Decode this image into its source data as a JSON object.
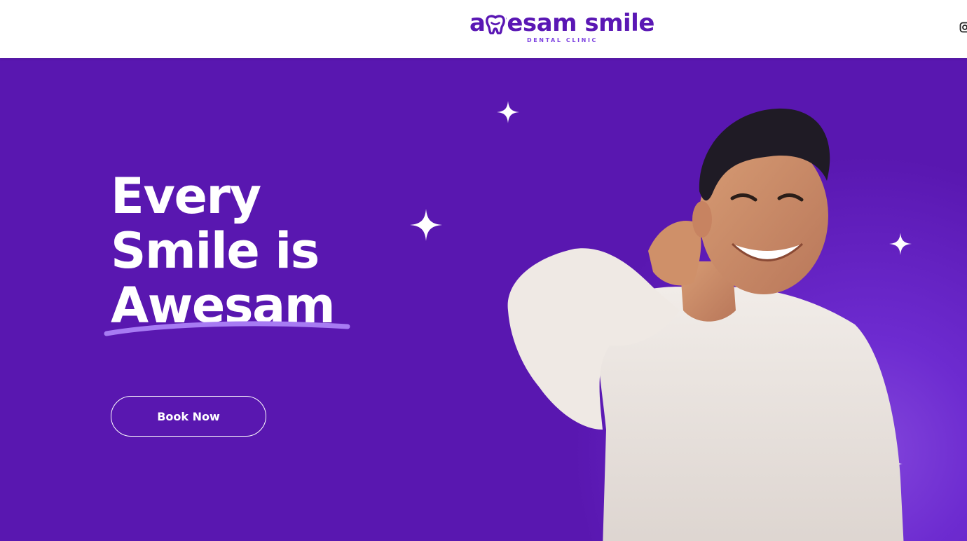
{
  "header": {
    "logo": {
      "brand_name": "awesam smile",
      "tagline": "DENTAL CLINIC"
    },
    "social": {
      "icon": "instagram-icon"
    }
  },
  "hero": {
    "headline": {
      "line1": "Every",
      "line2": "Smile is",
      "line3": "Awesam"
    },
    "cta_label": "Book Now",
    "image": "smiling-man-photo"
  },
  "colors": {
    "brand_purple": "#5a17b4",
    "hero_background": "#5917b0",
    "underline_accent": "#a77bf3",
    "text_light": "#ffffff"
  }
}
